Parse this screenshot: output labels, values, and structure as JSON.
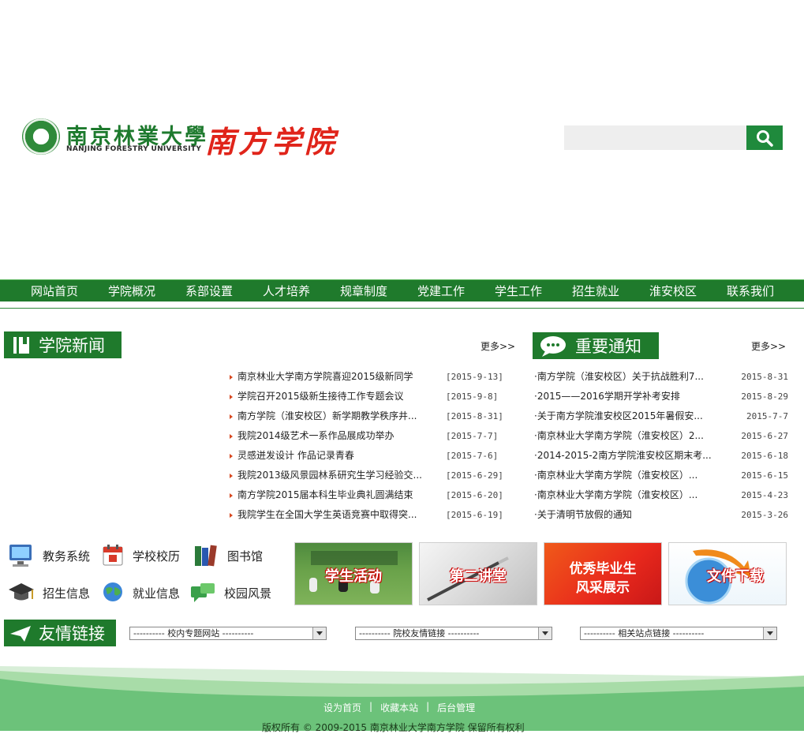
{
  "header": {
    "logo_cn": "南京林業大學",
    "logo_en": "NANJING FORESTRY UNIVERSITY",
    "school_name": "南方学院",
    "search_placeholder": ""
  },
  "nav": {
    "items": [
      "网站首页",
      "学院概况",
      "系部设置",
      "人才培养",
      "规章制度",
      "党建工作",
      "学生工作",
      "招生就业",
      "淮安校区",
      "联系我们"
    ]
  },
  "news": {
    "title": "学院新闻",
    "more": "更多>>",
    "items": [
      {
        "title": "南京林业大学南方学院喜迎2015级新同学",
        "date": "[2015-9-13]"
      },
      {
        "title": "学院召开2015级新生接待工作专题会议",
        "date": "[2015-9-8]"
      },
      {
        "title": "南方学院（淮安校区）新学期教学秩序井...",
        "date": "[2015-8-31]"
      },
      {
        "title": "我院2014级艺术一系作品展成功举办",
        "date": "[2015-7-7]"
      },
      {
        "title": "灵感迸发设计 作品记录青春",
        "date": "[2015-7-6]"
      },
      {
        "title": "我院2013级风景园林系研究生学习经验交...",
        "date": "[2015-6-29]"
      },
      {
        "title": "南方学院2015届本科生毕业典礼圆满结束",
        "date": "[2015-6-20]"
      },
      {
        "title": "我院学生在全国大学生英语竞赛中取得突...",
        "date": "[2015-6-19]"
      }
    ]
  },
  "notice": {
    "title": "重要通知",
    "more": "更多>>",
    "items": [
      {
        "title": "·南方学院（淮安校区）关于抗战胜利7...",
        "date": "2015-8-31"
      },
      {
        "title": "·2015——2016学期开学补考安排",
        "date": "2015-8-29"
      },
      {
        "title": "·关于南方学院淮安校区2015年暑假安...",
        "date": "2015-7-7"
      },
      {
        "title": "·南京林业大学南方学院（淮安校区）2...",
        "date": "2015-6-27"
      },
      {
        "title": "·2014-2015-2南方学院淮安校区期末考...",
        "date": "2015-6-18"
      },
      {
        "title": "·南京林业大学南方学院（淮安校区）...",
        "date": "2015-6-15"
      },
      {
        "title": "·南京林业大学南方学院（淮安校区）...",
        "date": "2015-4-23"
      },
      {
        "title": "·关于清明节放假的通知",
        "date": "2015-3-26"
      }
    ]
  },
  "quick_links": [
    {
      "label": "教务系统",
      "icon": "monitor-icon"
    },
    {
      "label": "学校校历",
      "icon": "calendar-icon"
    },
    {
      "label": "图书馆",
      "icon": "books-icon"
    },
    {
      "label": "招生信息",
      "icon": "graduation-cap-icon"
    },
    {
      "label": "就业信息",
      "icon": "globe-icon"
    },
    {
      "label": "校园风景",
      "icon": "chat-bubbles-icon"
    }
  ],
  "banners": [
    {
      "label": "学生活动"
    },
    {
      "label": "第二讲堂"
    },
    {
      "label_line1": "优秀毕业生",
      "label_line2": "风采展示"
    },
    {
      "label": "文件下载"
    }
  ],
  "friend_links": {
    "title": "友情链接",
    "selects": [
      "---------- 校内专题网站 ----------",
      "---------- 院校友情链接 ----------",
      "---------- 相关站点链接 ----------"
    ]
  },
  "footer": {
    "links": [
      "设为首页",
      "收藏本站",
      "后台管理"
    ],
    "separator": "|",
    "copyright": "版权所有 © 2009-2015 南京林业大学南方学院 保留所有权利"
  },
  "colors": {
    "brand_green": "#1f7a2c",
    "accent_red": "#e0241a",
    "light_green": "#7fc98a"
  }
}
